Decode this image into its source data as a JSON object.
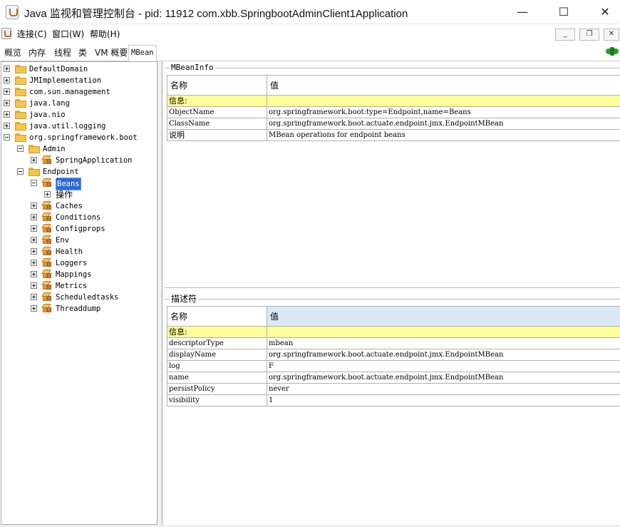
{
  "window": {
    "title": "Java 监视和管理控制台 - pid: 11912 com.xbb.SpringbootAdminClient1Application",
    "minimize": "—",
    "maximize": "☐",
    "close": "✕"
  },
  "menu": {
    "items": [
      "连接(C)",
      "窗口(W)",
      "帮助(H)"
    ],
    "mdi_buttons": [
      "_",
      "❐",
      "✕"
    ]
  },
  "tabs": {
    "items": [
      "概览",
      "内存",
      "线程",
      "类",
      "VM 概要",
      "MBean"
    ],
    "active": "MBean"
  },
  "tree": {
    "nodes": [
      {
        "label": "DefaultDomain",
        "type": "folder",
        "state": "collapsed"
      },
      {
        "label": "JMImplementation",
        "type": "folder",
        "state": "collapsed"
      },
      {
        "label": "com.sun.management",
        "type": "folder",
        "state": "collapsed"
      },
      {
        "label": "java.lang",
        "type": "folder",
        "state": "collapsed"
      },
      {
        "label": "java.nio",
        "type": "folder",
        "state": "collapsed"
      },
      {
        "label": "java.util.logging",
        "type": "folder",
        "state": "collapsed"
      },
      {
        "label": "org.springframework.boot",
        "type": "folder",
        "state": "expanded"
      },
      {
        "label": "Admin",
        "type": "folder",
        "state": "expanded"
      },
      {
        "label": "SpringApplication",
        "type": "bean",
        "state": "collapsed"
      },
      {
        "label": "Endpoint",
        "type": "folder",
        "state": "expanded"
      },
      {
        "label": "Beans",
        "type": "bean",
        "state": "expanded",
        "selected": true
      },
      {
        "label": "操作",
        "type": "none",
        "state": "collapsed"
      },
      {
        "label": "Caches",
        "type": "bean",
        "state": "collapsed"
      },
      {
        "label": "Conditions",
        "type": "bean",
        "state": "collapsed"
      },
      {
        "label": "Configprops",
        "type": "bean",
        "state": "collapsed"
      },
      {
        "label": "Env",
        "type": "bean",
        "state": "collapsed"
      },
      {
        "label": "Health",
        "type": "bean",
        "state": "collapsed"
      },
      {
        "label": "Loggers",
        "type": "bean",
        "state": "collapsed"
      },
      {
        "label": "Mappings",
        "type": "bean",
        "state": "collapsed"
      },
      {
        "label": "Metrics",
        "type": "bean",
        "state": "collapsed"
      },
      {
        "label": "Scheduledtasks",
        "type": "bean",
        "state": "collapsed"
      },
      {
        "label": "Threaddump",
        "type": "bean",
        "state": "collapsed"
      }
    ]
  },
  "mbeaninfo": {
    "title": "MBeanInfo",
    "headers": [
      "名称",
      "值"
    ],
    "section": "信息:",
    "rows": [
      [
        "ObjectName",
        "org.springframework.boot:type=Endpoint,name=Beans"
      ],
      [
        "ClassName",
        "org.springframework.boot.actuate.endpoint.jmx.EndpointMBean"
      ],
      [
        "说明",
        "MBean operations for endpoint beans"
      ]
    ]
  },
  "descriptor": {
    "title": "描述符",
    "headers": [
      "名称",
      "值"
    ],
    "section": "信息:",
    "rows": [
      [
        "descriptorType",
        "mbean"
      ],
      [
        "displayName",
        "org.springframework.boot.actuate.endpoint.jmx.EndpointMBean"
      ],
      [
        "log",
        "F"
      ],
      [
        "name",
        "org.springframework.boot.actuate.endpoint.jmx.EndpointMBean"
      ],
      [
        "persistPolicy",
        "never"
      ],
      [
        "visibility",
        "1"
      ]
    ]
  },
  "colors": {
    "selection": "#2b6bd6",
    "info_row": "#ffff99",
    "header_accent": "#dbe8f5",
    "connected": "#2e9a32"
  }
}
